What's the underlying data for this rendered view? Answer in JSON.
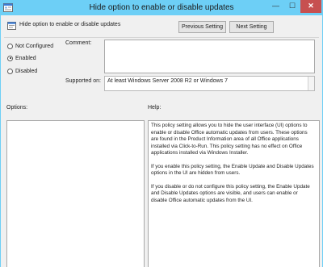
{
  "window": {
    "title": "Hide option to enable or disable updates",
    "minimize_glyph": "—",
    "maximize_glyph": "☐",
    "close_glyph": "✕"
  },
  "header": {
    "policy_name": "Hide option to enable or disable updates",
    "prev_label": "Previous Setting",
    "next_label": "Next Setting"
  },
  "state": {
    "options": [
      {
        "label": "Not Configured",
        "selected": false
      },
      {
        "label": "Enabled",
        "selected": true
      },
      {
        "label": "Disabled",
        "selected": false
      }
    ]
  },
  "comment": {
    "label": "Comment:",
    "value": ""
  },
  "supported": {
    "label": "Supported on:",
    "value": "At least Windows Server 2008 R2 or Windows 7"
  },
  "options_panel": {
    "label": "Options:"
  },
  "help_panel": {
    "label": "Help:",
    "paragraphs": [
      "This policy setting allows you to hide the user interface (UI) options to enable or disable Office automatic updates from users. These options are found in the Product Information area of all Office applications installed via Click-to-Run. This policy setting has no effect on Office applications installed via Windows Installer.",
      "If you enable this policy setting, the Enable Update and Disable Updates options in the UI are hidden from users.",
      "If you disable or do not configure this policy setting, the Enable Update and Disable Updates options are visible, and users can enable or disable Office automatic updates from the UI."
    ]
  },
  "colors": {
    "titlebar": "#6dcff6",
    "close_button": "#c75050",
    "window_bg": "#f0f0f0"
  },
  "icons": [
    "policy-settings-icon",
    "minimize-icon",
    "maximize-icon",
    "close-icon"
  ]
}
